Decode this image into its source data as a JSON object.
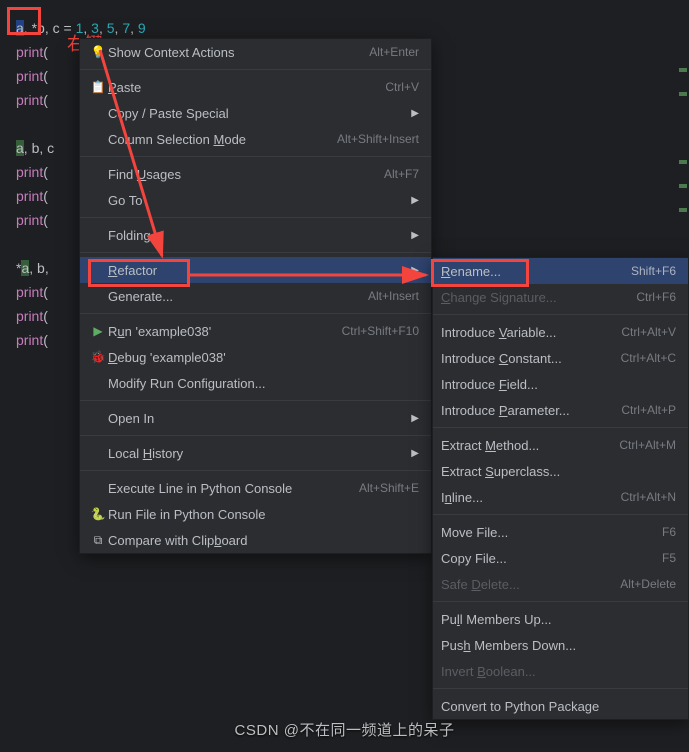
{
  "annotations": {
    "right_click": "右键"
  },
  "code": {
    "line1_pre": "a",
    "line1_rest": ", *b, c = ",
    "line1_nums_html": "1, 3, 5, 7, 9",
    "line2": "print(",
    "line3": "print(",
    "line4": "print(",
    "line5_a": "a",
    "line5_rest": ", b, c",
    "line6": "print(",
    "line7": "print(",
    "line8": "print(",
    "line9_star": "*",
    "line9_a": "a",
    "line9_rest": ", b,",
    "line10": "print(",
    "line11": "print(",
    "line12": "print("
  },
  "menu": {
    "context_actions": "Show Context Actions",
    "context_actions_sc": "Alt+Enter",
    "paste": "Paste",
    "paste_sc": "Ctrl+V",
    "copy_paste_special": "Copy / Paste Special",
    "column_selection": "Column Selection Mode",
    "column_selection_sc": "Alt+Shift+Insert",
    "find_usages": "Find Usages",
    "find_usages_sc": "Alt+F7",
    "go_to": "Go To",
    "folding": "Folding",
    "refactor": "Refactor",
    "generate": "Generate...",
    "generate_sc": "Alt+Insert",
    "run": "Run 'example038'",
    "run_sc": "Ctrl+Shift+F10",
    "debug": "Debug 'example038'",
    "modify_run": "Modify Run Configuration...",
    "open_in": "Open In",
    "local_history": "Local History",
    "exec_line": "Execute Line in Python Console",
    "exec_line_sc": "Alt+Shift+E",
    "run_file": "Run File in Python Console",
    "compare": "Compare with Clipboard"
  },
  "submenu": {
    "rename": "Rename...",
    "rename_sc": "Shift+F6",
    "change_sig": "Change Signature...",
    "change_sig_sc": "Ctrl+F6",
    "intro_var": "Introduce Variable...",
    "intro_var_sc": "Ctrl+Alt+V",
    "intro_const": "Introduce Constant...",
    "intro_const_sc": "Ctrl+Alt+C",
    "intro_field": "Introduce Field...",
    "intro_param": "Introduce Parameter...",
    "intro_param_sc": "Ctrl+Alt+P",
    "extract_method": "Extract Method...",
    "extract_method_sc": "Ctrl+Alt+M",
    "extract_super": "Extract Superclass...",
    "inline": "Inline...",
    "inline_sc": "Ctrl+Alt+N",
    "move": "Move File...",
    "move_sc": "F6",
    "copy": "Copy File...",
    "copy_sc": "F5",
    "safe_delete": "Safe Delete...",
    "safe_delete_sc": "Alt+Delete",
    "pull_up": "Pull Members Up...",
    "push_down": "Push Members Down...",
    "invert_bool": "Invert Boolean...",
    "convert_pkg": "Convert to Python Package"
  },
  "watermark": "CSDN @不在同一频道上的呆子"
}
